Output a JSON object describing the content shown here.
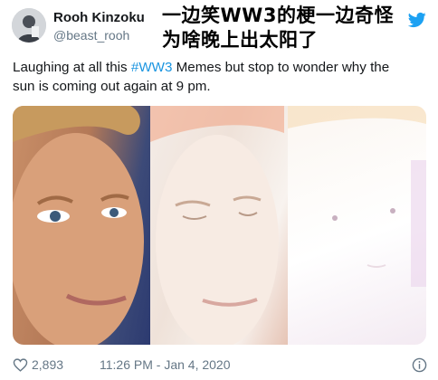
{
  "user": {
    "display_name": "Rooh Kinzoku",
    "handle": "@beast_rooh"
  },
  "overlay_caption": "一边笑WW3的梗一边奇怪为啥晚上出太阳了",
  "tweet": {
    "text_before": "Laughing at all this ",
    "hashtag": "#WW3",
    "text_after": " Memes but stop to wonder why the\nsun is coming out again at 9 pm."
  },
  "footer": {
    "like_count": "2,893",
    "timestamp": "11:26 PM - Jan 4, 2020"
  },
  "icons": {
    "brand": "twitter-bird-icon",
    "like": "heart-icon",
    "info": "info-icon"
  },
  "colors": {
    "hashtag": "#1b95e0",
    "twitter_blue": "#1da1f2",
    "meta_gray": "#657786"
  }
}
